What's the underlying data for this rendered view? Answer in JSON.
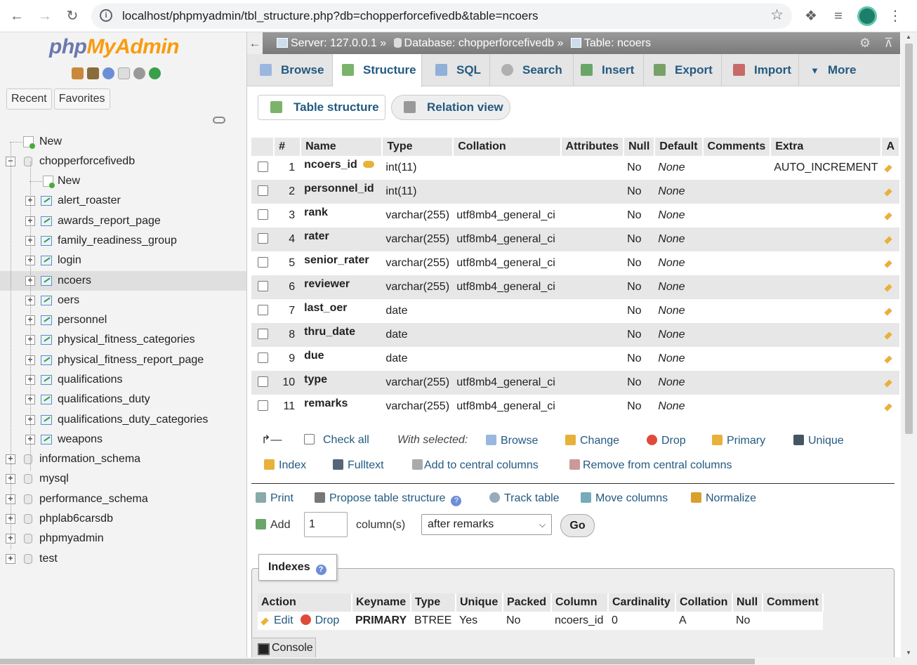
{
  "browser": {
    "url": "localhost/phpmyadmin/tbl_structure.php?db=chopperforcefivedb&table=ncoers"
  },
  "sidebar": {
    "logo_part1": "php",
    "logo_part2": "MyAdmin",
    "tabs": [
      "Recent",
      "Favorites"
    ],
    "tree": [
      {
        "label": "New",
        "kind": "new",
        "level": 0
      },
      {
        "label": "chopperforcefivedb",
        "kind": "db",
        "level": 0,
        "expanded": true
      },
      {
        "label": "New",
        "kind": "new",
        "level": 1
      },
      {
        "label": "alert_roaster",
        "kind": "table",
        "level": 1
      },
      {
        "label": "awards_report_page",
        "kind": "table",
        "level": 1
      },
      {
        "label": "family_readiness_group",
        "kind": "table",
        "level": 1
      },
      {
        "label": "login",
        "kind": "table",
        "level": 1
      },
      {
        "label": "ncoers",
        "kind": "table",
        "level": 1,
        "selected": true
      },
      {
        "label": "oers",
        "kind": "table",
        "level": 1
      },
      {
        "label": "personnel",
        "kind": "table",
        "level": 1
      },
      {
        "label": "physical_fitness_categories",
        "kind": "table",
        "level": 1
      },
      {
        "label": "physical_fitness_report_page",
        "kind": "table",
        "level": 1
      },
      {
        "label": "qualifications",
        "kind": "table",
        "level": 1
      },
      {
        "label": "qualifications_duty",
        "kind": "table",
        "level": 1
      },
      {
        "label": "qualifications_duty_categories",
        "kind": "table",
        "level": 1
      },
      {
        "label": "weapons",
        "kind": "table",
        "level": 1
      },
      {
        "label": "information_schema",
        "kind": "db",
        "level": 0
      },
      {
        "label": "mysql",
        "kind": "db",
        "level": 0
      },
      {
        "label": "performance_schema",
        "kind": "db",
        "level": 0
      },
      {
        "label": "phplab6carsdb",
        "kind": "db",
        "level": 0
      },
      {
        "label": "phpmyadmin",
        "kind": "db",
        "level": 0
      },
      {
        "label": "test",
        "kind": "db",
        "level": 0
      }
    ]
  },
  "topbar": {
    "server": "Server: 127.0.0.1 »",
    "database": "Database: chopperforcefivedb »",
    "table": "Table: ncoers"
  },
  "tabs": [
    "Browse",
    "Structure",
    "SQL",
    "Search",
    "Insert",
    "Export",
    "Import",
    "More"
  ],
  "active_tab": "Structure",
  "subtabs": [
    "Table structure",
    "Relation view"
  ],
  "columns_header": [
    "#",
    "Name",
    "Type",
    "Collation",
    "Attributes",
    "Null",
    "Default",
    "Comments",
    "Extra",
    "A"
  ],
  "columns": [
    {
      "num": "1",
      "name": "ncoers_id",
      "type": "int(11)",
      "collation": "",
      "null": "No",
      "default": "None",
      "extra": "AUTO_INCREMENT",
      "primary": true
    },
    {
      "num": "2",
      "name": "personnel_id",
      "type": "int(11)",
      "collation": "",
      "null": "No",
      "default": "None",
      "extra": ""
    },
    {
      "num": "3",
      "name": "rank",
      "type": "varchar(255)",
      "collation": "utf8mb4_general_ci",
      "null": "No",
      "default": "None",
      "extra": ""
    },
    {
      "num": "4",
      "name": "rater",
      "type": "varchar(255)",
      "collation": "utf8mb4_general_ci",
      "null": "No",
      "default": "None",
      "extra": ""
    },
    {
      "num": "5",
      "name": "senior_rater",
      "type": "varchar(255)",
      "collation": "utf8mb4_general_ci",
      "null": "No",
      "default": "None",
      "extra": ""
    },
    {
      "num": "6",
      "name": "reviewer",
      "type": "varchar(255)",
      "collation": "utf8mb4_general_ci",
      "null": "No",
      "default": "None",
      "extra": ""
    },
    {
      "num": "7",
      "name": "last_oer",
      "type": "date",
      "collation": "",
      "null": "No",
      "default": "None",
      "extra": ""
    },
    {
      "num": "8",
      "name": "thru_date",
      "type": "date",
      "collation": "",
      "null": "No",
      "default": "None",
      "extra": ""
    },
    {
      "num": "9",
      "name": "due",
      "type": "date",
      "collation": "",
      "null": "No",
      "default": "None",
      "extra": ""
    },
    {
      "num": "10",
      "name": "type",
      "type": "varchar(255)",
      "collation": "utf8mb4_general_ci",
      "null": "No",
      "default": "None",
      "extra": ""
    },
    {
      "num": "11",
      "name": "remarks",
      "type": "varchar(255)",
      "collation": "utf8mb4_general_ci",
      "null": "No",
      "default": "None",
      "extra": ""
    }
  ],
  "bulk": {
    "check_all": "Check all",
    "with_selected": "With selected:",
    "row1": [
      "Browse",
      "Change",
      "Drop",
      "Primary",
      "Unique"
    ],
    "row2": [
      "Index",
      "Fulltext",
      "Add to central columns",
      "Remove from central columns"
    ]
  },
  "tools": [
    "Print",
    "Propose table structure",
    "Track table",
    "Move columns",
    "Normalize"
  ],
  "add_column": {
    "label": "Add",
    "count": "1",
    "unit": "column(s)",
    "position": "after remarks",
    "go": "Go"
  },
  "indexes": {
    "legend": "Indexes",
    "header": [
      "Action",
      "Keyname",
      "Type",
      "Unique",
      "Packed",
      "Column",
      "Cardinality",
      "Collation",
      "Null",
      "Comment"
    ],
    "rows": [
      {
        "edit": "Edit",
        "drop": "Drop",
        "keyname": "PRIMARY",
        "type": "BTREE",
        "unique": "Yes",
        "packed": "No",
        "column": "ncoers_id",
        "cardinality": "0",
        "collation": "A",
        "null": "No",
        "comment": ""
      }
    ]
  },
  "console": "Console",
  "colors": {
    "link": "#235a81",
    "logo_php": "#6c78af",
    "logo_myadmin": "#f89c0e"
  }
}
